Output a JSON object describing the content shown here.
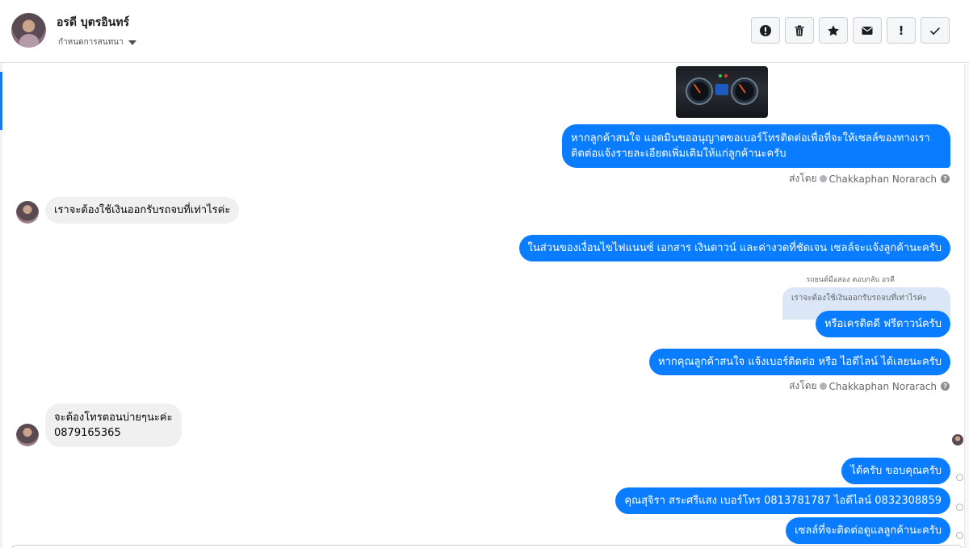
{
  "header": {
    "contact_name": "อรดี บุตรอินทร์",
    "label_dropdown": "กำหนดการสนทนา",
    "toolbar": [
      {
        "name": "spam-button",
        "icon": "alert-circle-icon"
      },
      {
        "name": "delete-button",
        "icon": "trash-icon"
      },
      {
        "name": "star-button",
        "icon": "star-icon"
      },
      {
        "name": "mark-unread-button",
        "icon": "envelope-icon"
      },
      {
        "name": "important-button",
        "icon": "exclamation-icon",
        "glyph": "!"
      },
      {
        "name": "done-button",
        "icon": "checkmark-icon"
      }
    ]
  },
  "messages": {
    "m1_out": {
      "line1": "หากลูกค้าสนใจ แอดมินขออนุญาตขอเบอร์โทรติดต่อเพื่อที่จะให้เซลล์ของทางเรา",
      "line2": "ติดต่อแจ้งรายละเอียดเพิ่มเติมให้แก่ลูกค้านะครับ"
    },
    "sent_by_1": {
      "prefix": "ส่งโดย",
      "agent": "Chakkaphan Norarach"
    },
    "m2_in": "เราจะต้องใช้เงินออกรับรถจบที่เท่าไรค่ะ",
    "m3_out": "ในส่วนของเงื่อนไขไฟแนนซ์ เอกสาร เงินดาวน์ และค่างวดที่ชัดเจน เซลล์จะแจ้งลูกค้านะครับ",
    "reply_caption": "รถยนต์มือสอง ตอบกลับ อรดี",
    "quoted_text": "เราจะต้องใช้เงินออกรับรถจบที่เท่าไรค่ะ",
    "m4_out": "หรือเครดิตดี ฟรีดาวน์ครับ",
    "m5_out": "หากคุณลูกค้าสนใจ แจ้งเบอร์ติดต่อ หรือ ไอดีไลน์ ได้เลยนะครับ",
    "sent_by_2": {
      "prefix": "ส่งโดย",
      "agent": "Chakkaphan Norarach"
    },
    "m6_in": {
      "line1": "จะต้องโทรตอนบ่ายๆนะค่ะ",
      "line2": "0879165365"
    },
    "m7_out": "ได้ครับ ขอบคุณครับ",
    "m8_out": "คุณสุจิรา สระศรีแสง      เบอร์โทร 0813781787  ไอดีไลน์ 0832308859",
    "m9_out": "เซลล์ที่จะติดต่อดูแลลูกค้านะครับ"
  },
  "colors": {
    "outgoing_bubble": "#0a7cff",
    "incoming_bubble": "#f0f0f0",
    "quoted_bubble": "#dbe7f7",
    "accent": "#1877f2"
  }
}
